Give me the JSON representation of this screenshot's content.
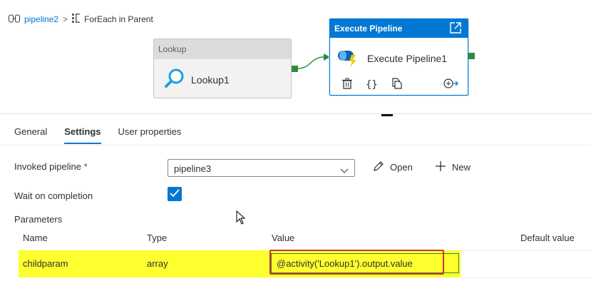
{
  "breadcrumb": {
    "pipeline": "pipeline2",
    "separator": ">",
    "current": "ForEach in Parent"
  },
  "canvas": {
    "lookup_node": {
      "header": "Lookup",
      "name": "Lookup1",
      "icon": "magnifier-icon"
    },
    "execute_node": {
      "header": "Execute Pipeline",
      "name": "Execute Pipeline1",
      "icon": "execute-pipeline-icon",
      "actions": [
        "delete-icon",
        "code-icon",
        "copy-icon",
        "add-output-icon"
      ],
      "action_code_label": "{}"
    }
  },
  "tabs": [
    {
      "label": "General",
      "active": false
    },
    {
      "label": "Settings",
      "active": true
    },
    {
      "label": "User properties",
      "active": false
    }
  ],
  "settings": {
    "invoked_pipeline_label": "Invoked pipeline",
    "required_mark": "*",
    "invoked_pipeline_value": "pipeline3",
    "open_label": "Open",
    "new_label": "New",
    "wait_label": "Wait on completion",
    "wait_checked": true,
    "parameters_label": "Parameters"
  },
  "parameters": {
    "columns": [
      "Name",
      "Type",
      "Value",
      "Default value"
    ],
    "rows": [
      {
        "name": "childparam",
        "type": "array",
        "value": "@activity('Lookup1').output.value",
        "default": ""
      }
    ]
  },
  "colors": {
    "accent": "#0078d4",
    "row_highlight": "#fdff2f",
    "annotation_border": "#d13438",
    "port": "#2e8b3e"
  }
}
